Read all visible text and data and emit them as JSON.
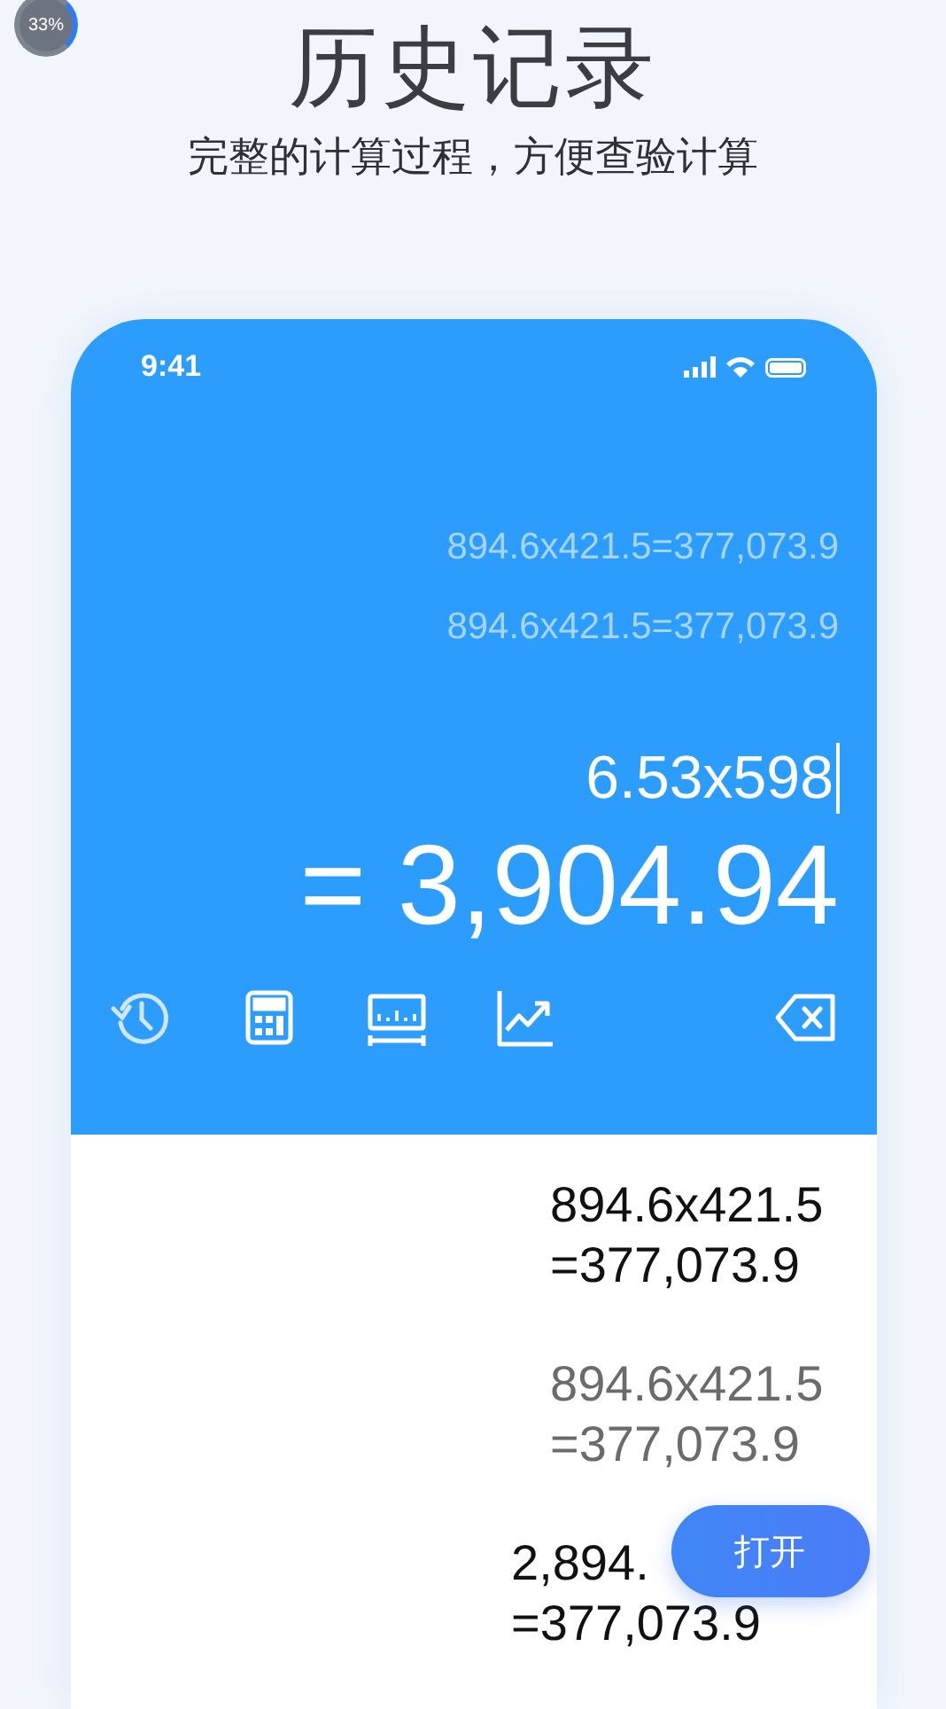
{
  "progress_badge": {
    "text": "33%"
  },
  "title": "历史记录",
  "subtitle": "完整的计算过程，方便查验计算",
  "status_bar": {
    "time": "9:41"
  },
  "tape": [
    "894.6x421.5=377,073.9",
    "894.6x421.5=377,073.9"
  ],
  "expression": "6.53x598",
  "result": "= 3,904.94",
  "toolbar": [
    {
      "kind": "history"
    },
    {
      "kind": "calculator"
    },
    {
      "kind": "ruler"
    },
    {
      "kind": "chart"
    },
    {
      "kind": "backspace"
    }
  ],
  "history": [
    {
      "lines": [
        "894.6x421.5",
        "=377,073.9"
      ],
      "muted": false
    },
    {
      "lines": [
        "894.6x421.5",
        "=377,073.9"
      ],
      "muted": true
    },
    {
      "lines": [
        "2,894.",
        "=377,073.9"
      ],
      "muted": false
    }
  ],
  "open_button": "打开"
}
